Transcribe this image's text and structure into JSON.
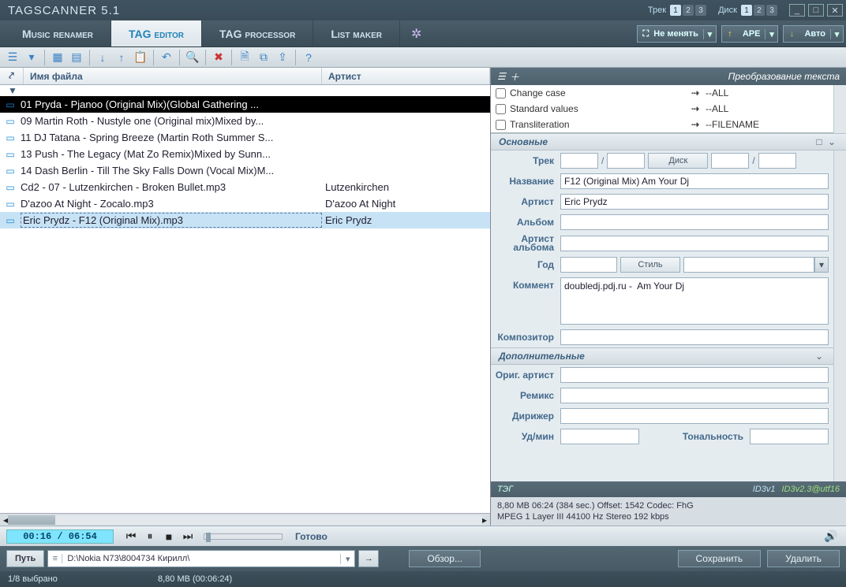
{
  "app": {
    "title": "TAGSCANNER 5.1"
  },
  "titlebar": {
    "track_label": "Трек",
    "disc_label": "Диск",
    "track_pills": [
      "1",
      "2",
      "3"
    ],
    "disc_pills": [
      "1",
      "2",
      "3"
    ],
    "track_active": 0,
    "disc_active": 0
  },
  "tabs": {
    "items": [
      {
        "label": "Music renamer"
      },
      {
        "label": "TAG editor"
      },
      {
        "label": "TAG processor"
      },
      {
        "label": "List maker"
      }
    ],
    "active": 1
  },
  "combos": {
    "resize": "Не менять",
    "format": "APE",
    "auto": "Авто"
  },
  "list": {
    "col_filename": "Имя файла",
    "col_artist": "Артист",
    "rows": [
      {
        "name": "01 Pryda - Pjanoo (Original Mix)(Global Gathering ...",
        "artist": "",
        "current": true
      },
      {
        "name": "09 Martin Roth -  Nustyle one (Original mix)Mixed by...",
        "artist": ""
      },
      {
        "name": "11 DJ Tatana - Spring Breeze (Martin Roth Summer S...",
        "artist": ""
      },
      {
        "name": "13 Push - The Legacy (Mat Zo Remix)Mixed by Sunn...",
        "artist": ""
      },
      {
        "name": "14 Dash Berlin - Till The Sky Falls Down (Vocal Mix)M...",
        "artist": ""
      },
      {
        "name": "Cd2 - 07 - Lutzenkirchen - Broken Bullet.mp3",
        "artist": "Lutzenkirchen"
      },
      {
        "name": "D'azoo At Night - Zocalo.mp3",
        "artist": "D'azoo At Night"
      },
      {
        "name": "Eric Prydz - F12 (Original Mix).mp3",
        "artist": "Eric Prydz",
        "selected": true
      }
    ]
  },
  "transforms": {
    "header": "Преобразование текста",
    "rows": [
      {
        "label": "Change case",
        "value": "--ALL"
      },
      {
        "label": "Standard values",
        "value": "--ALL"
      },
      {
        "label": "Transliteration",
        "value": "--FILENAME"
      }
    ]
  },
  "sections": {
    "main": "Основные",
    "extra": "Дополнительные"
  },
  "fields": {
    "track": "Трек",
    "disc": "Диск",
    "title": "Название",
    "artist": "Артист",
    "album": "Альбом",
    "albumartist": "Артист альбома",
    "year": "Год",
    "genre": "Стиль",
    "comment": "Коммент",
    "composer": "Композитор",
    "origartist": "Ориг. артист",
    "remix": "Ремикс",
    "conductor": "Дирижер",
    "bpm": "Уд/мин",
    "key": "Тональность"
  },
  "values": {
    "track": "",
    "track_total": "",
    "disc": "",
    "disc_total": "",
    "title": "F12 (Original Mix) Am Your Dj",
    "artist": "Eric Prydz",
    "album": "",
    "albumartist": "",
    "year": "",
    "genre": "",
    "comment": "doubledj.pdj.ru -  Am Your Dj",
    "composer": "",
    "origartist": "",
    "remix": "",
    "conductor": ""
  },
  "tagstrip": {
    "label": "ТЭГ",
    "v1": "ID3v1",
    "v2": "ID3v2.3@utf16"
  },
  "meta": {
    "line1": "8,80 MB 06:24 (384 sec.)  Offset: 1542  Codec: FhG",
    "line2": "MPEG 1 Layer III  44100 Hz  Stereo  192 kbps"
  },
  "player": {
    "time": "00:16 / 06:54",
    "status": "Готово"
  },
  "pathbar": {
    "path_label": "Путь",
    "path_value": "D:\\Nokia N73\\8004734 Кирилл\\",
    "browse": "Обзор...",
    "save": "Сохранить",
    "delete": "Удалить"
  },
  "status": {
    "selection": "1/8 выбрано",
    "size": "8,80 MB  (00:06:24)"
  }
}
